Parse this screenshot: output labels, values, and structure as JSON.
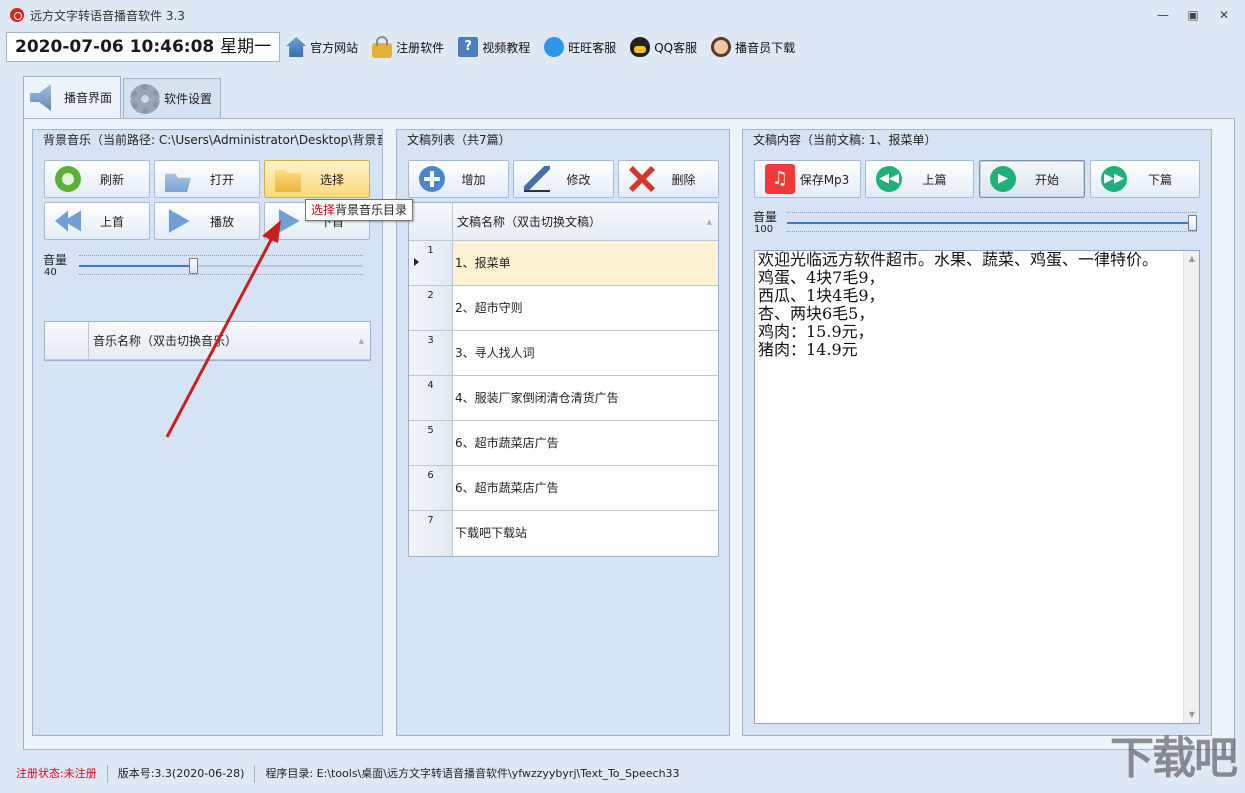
{
  "window": {
    "title": "远方文字转语音播音软件 3.3"
  },
  "toolbar": {
    "datetime": "2020-07-06 10:46:08",
    "weekday": "星期一",
    "items": [
      {
        "label": "官方网站",
        "icon": "home-icon"
      },
      {
        "label": "注册软件",
        "icon": "lock-icon"
      },
      {
        "label": "视频教程",
        "icon": "help-icon"
      },
      {
        "label": "旺旺客服",
        "icon": "wangwang-icon"
      },
      {
        "label": "QQ客服",
        "icon": "qq-icon"
      },
      {
        "label": "播音员下载",
        "icon": "user-icon"
      }
    ]
  },
  "tabs": [
    {
      "label": "播音界面",
      "icon": "speaker-icon",
      "active": true
    },
    {
      "label": "软件设置",
      "icon": "gear-icon",
      "active": false
    }
  ],
  "bg_music": {
    "title": "背景音乐（当前路径: C:\\Users\\Administrator\\Desktop\\背景音乐）",
    "buttons": {
      "refresh": "刷新",
      "open": "打开",
      "select": "选择",
      "prev": "上首",
      "play": "播放",
      "next": "下首"
    },
    "volume_label": "音量",
    "volume": 40,
    "column": "音乐名称（双击切换音乐）",
    "tooltip_highlight": "选择",
    "tooltip_rest": "背景音乐目录"
  },
  "scripts": {
    "title": "文稿列表（共7篇）",
    "buttons": {
      "add": "增加",
      "edit": "修改",
      "delete": "删除"
    },
    "column": "文稿名称（双击切换文稿）",
    "rows": [
      {
        "num": "1",
        "name": "1、报菜单"
      },
      {
        "num": "2",
        "name": "2、超市守则"
      },
      {
        "num": "3",
        "name": "3、寻人找人词"
      },
      {
        "num": "4",
        "name": "4、服装厂家倒闭清仓清货广告"
      },
      {
        "num": "5",
        "name": "6、超市蔬菜店广告"
      },
      {
        "num": "6",
        "name": "6、超市蔬菜店广告"
      },
      {
        "num": "7",
        "name": "下载吧下载站"
      }
    ],
    "selected_index": 0
  },
  "content": {
    "title": "文稿内容（当前文稿: 1、报菜单）",
    "buttons": {
      "save_mp3": "保存Mp3",
      "prev": "上篇",
      "start": "开始",
      "next": "下篇"
    },
    "volume_label": "音量",
    "volume": 100,
    "text": "欢迎光临远方软件超市。水果、蔬菜、鸡蛋、一律特价。\n鸡蛋、4块7毛9，\n西瓜、1块4毛9，\n杏、两块6毛5，\n鸡肉：15.9元，\n猪肉：14.9元"
  },
  "status": {
    "reg_label": "注册状态:",
    "reg_value": "未注册",
    "version": "版本号:3.3(2020-06-28)",
    "path": "程序目录: E:\\tools\\桌面\\远方文字转语音播音软件\\yfwzzyybyrj\\Text_To_Speech33"
  },
  "colors": {
    "accent": "#3d7bc7",
    "hover": "#f9d97a",
    "selected_row": "#fdf2d2",
    "error_red": "#d0021b"
  }
}
